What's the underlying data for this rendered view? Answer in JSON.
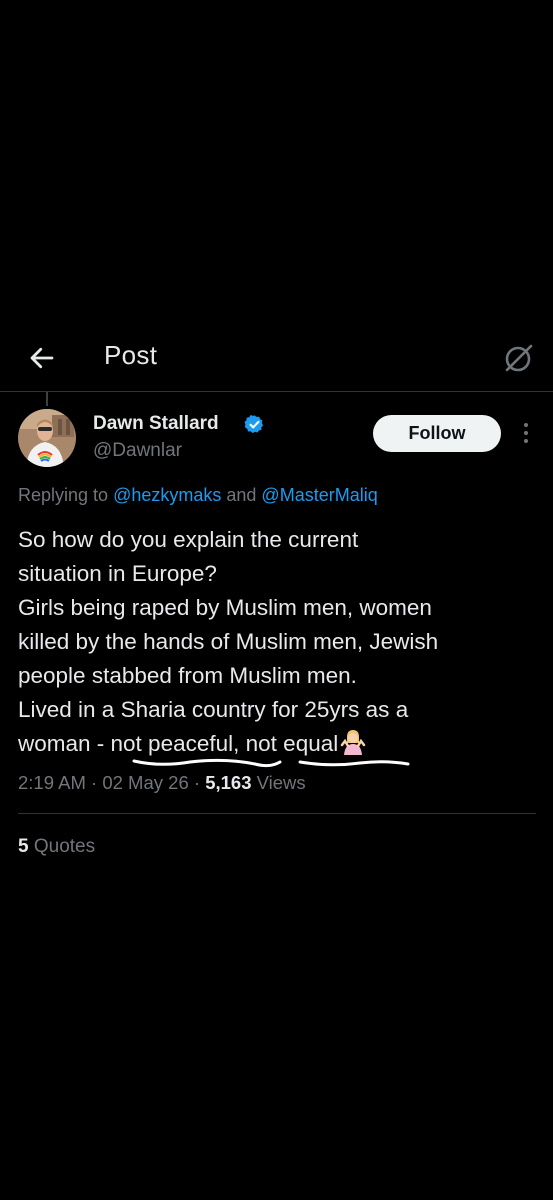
{
  "header": {
    "title": "Post",
    "back_icon": "arrow-left-icon",
    "right_icon": "grok-icon"
  },
  "author": {
    "display_name": "Dawn Stallard",
    "handle": "@Dawnlar",
    "verified_icon": "verified-badge-icon",
    "verified_color": "#1d9bf0"
  },
  "actions": {
    "follow_label": "Follow",
    "more_icon": "more-vertical-icon"
  },
  "reply_context": {
    "prefix": "Replying to ",
    "mention1": "@hezkymaks",
    "joiner": " and ",
    "mention2": "@MasterMaliq"
  },
  "tweet": {
    "line1": "So how do you explain the current",
    "line2": "situation in Europe?",
    "line3": "Girls being raped by Muslim men, women",
    "line4": "killed by the hands of Muslim men, Jewish",
    "line5": "people stabbed from Muslim men.",
    "line6": "Lived in a Sharia country for 25yrs as a",
    "line7_a": "woman - ",
    "line7_b": "not peaceful",
    "line7_c": ", ",
    "line7_d": "not equal",
    "emoji_icon": "person-shrugging-emoji-icon"
  },
  "meta": {
    "time": "2:19 AM",
    "sep1": " · ",
    "date": "02 May 26",
    "sep2": " · ",
    "views_count": "5,163",
    "views_label": " Views"
  },
  "stats": {
    "quotes_count": "5",
    "quotes_label": " Quotes"
  },
  "colors": {
    "background": "#000000",
    "text": "#e7e9ea",
    "secondary": "#71767b",
    "link": "#1d9bf0",
    "divider": "#2f3336",
    "follow_bg": "#eff3f4"
  }
}
